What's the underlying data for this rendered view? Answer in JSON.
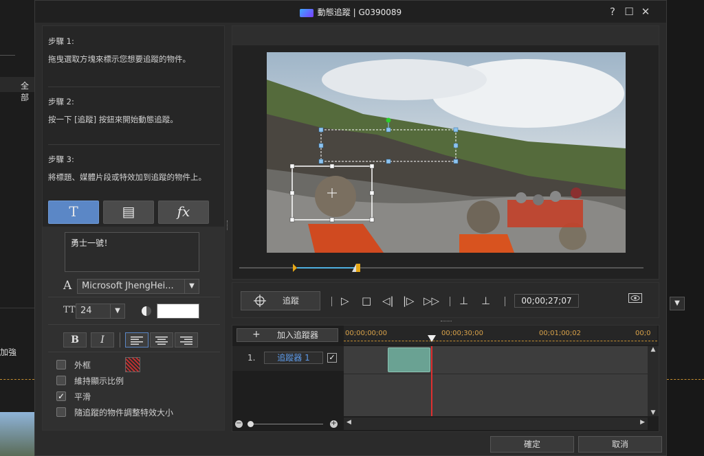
{
  "window": {
    "title": "動態追蹤 | G0390089",
    "help": "?",
    "maximize": "☐",
    "close": "✕"
  },
  "background": {
    "left_tab": "全部",
    "left_label": "加強"
  },
  "steps": [
    {
      "heading": "步驟 1:",
      "text": "拖曳選取方塊來標示您想要追蹤的物件。"
    },
    {
      "heading": "步驟 2:",
      "text": "按一下 [追蹤] 按鈕來開始動態追蹤。"
    },
    {
      "heading": "步驟 3:",
      "text": "將標題、媒體片段或特效加到追蹤的物件上。"
    }
  ],
  "tabs": {
    "title": "T",
    "media": "▤",
    "fx": "fx"
  },
  "text_panel": {
    "text_value": "勇士一號！",
    "font_icon": "A",
    "font_name": "Microsoft JhengHei...",
    "size_icon": "TT",
    "font_size": "24",
    "color_hex": "#ffffff",
    "bold": "B",
    "italic": "I"
  },
  "options": [
    {
      "label": "外框",
      "checked": false
    },
    {
      "label": "維持顯示比例",
      "checked": false
    },
    {
      "label": "平滑",
      "checked": true
    },
    {
      "label": "隨追蹤的物件調整特效大小",
      "checked": false
    }
  ],
  "controls": {
    "track_button": "追蹤",
    "timecode": "00;00;27;07"
  },
  "timeline": {
    "add_tracker": "加入追蹤器",
    "ticks": [
      "00;00;00;00",
      "00;00;30;00",
      "00;01;00;02",
      "00;0"
    ],
    "tracker_index": "1.",
    "tracker_name": "追蹤器 1"
  },
  "buttons": {
    "ok": "確定",
    "cancel": "取消"
  },
  "colors": {
    "accent": "#5b87c6",
    "clip": "#6aa293",
    "playhead": "#e03030",
    "trim": "#e6a817"
  }
}
